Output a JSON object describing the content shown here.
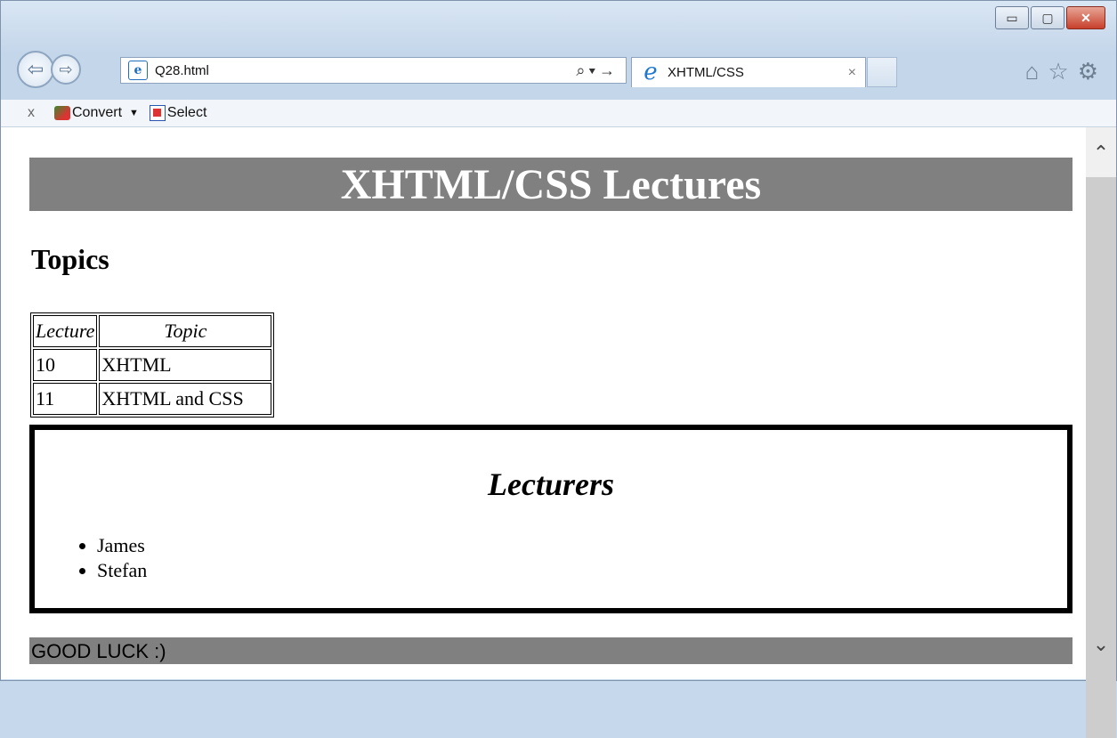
{
  "browser": {
    "window_buttons": {
      "minimize": "▭",
      "maximize": "▢",
      "close": "✕"
    },
    "address_bar": {
      "url": "Q28.html",
      "tools": "⌕▾→"
    },
    "tab": {
      "title": "XHTML/CSS",
      "close": "×"
    },
    "toolbar": {
      "close": "x",
      "convert_label": "Convert",
      "select_label": "Select"
    },
    "icons": [
      "home-icon",
      "star-icon",
      "gear-icon"
    ]
  },
  "page": {
    "banner_title": "XHTML/CSS Lectures",
    "topics_heading": "Topics",
    "table": {
      "headers": [
        "Lecture",
        "Topic"
      ],
      "rows": [
        [
          "10",
          "XHTML"
        ],
        [
          "11",
          "XHTML and CSS"
        ]
      ]
    },
    "lecturers_heading": "Lecturers",
    "lecturers": [
      "James",
      "Stefan"
    ],
    "footer": "GOOD LUCK :)"
  }
}
